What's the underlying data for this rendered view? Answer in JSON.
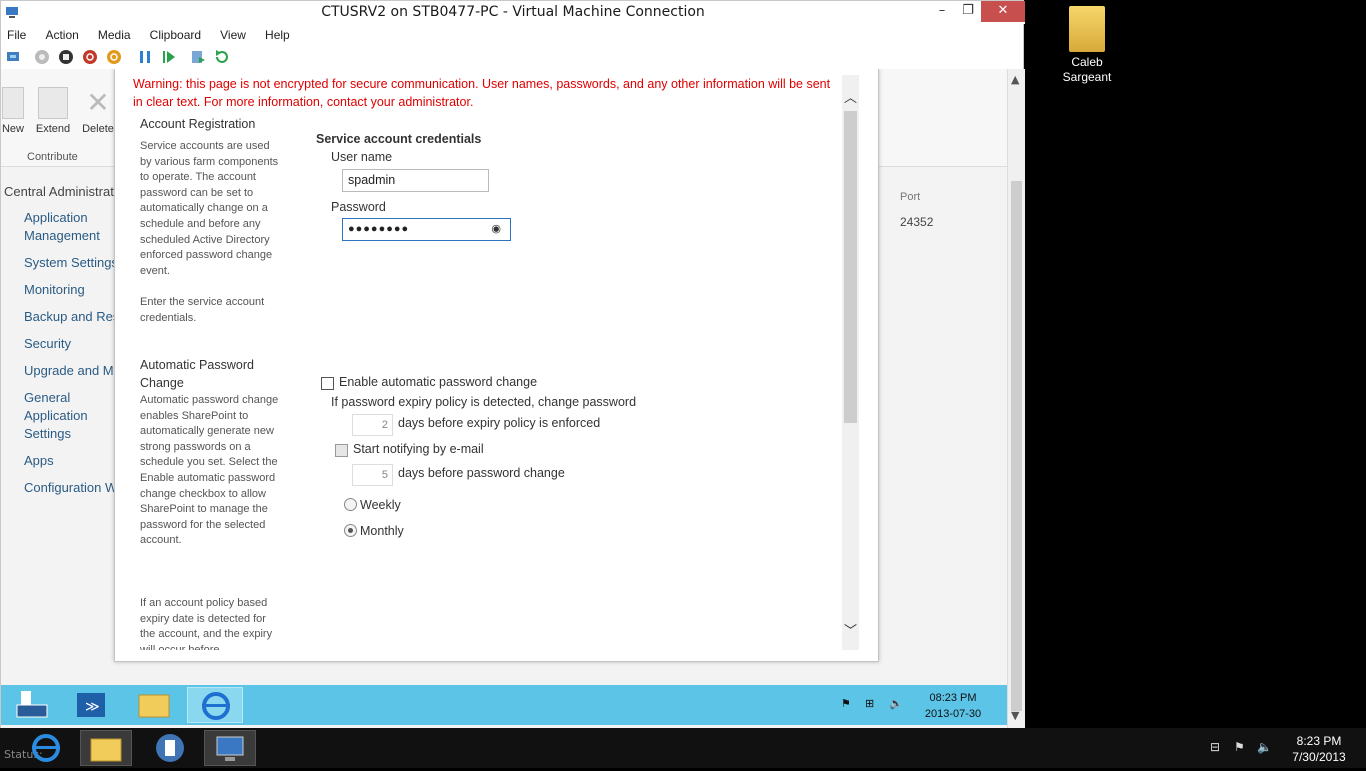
{
  "window": {
    "title": "CTUSRV2 on STB0477-PC - Virtual Machine Connection",
    "min": "–",
    "max": "❐",
    "close": "✕"
  },
  "menu": [
    "File",
    "Action",
    "Media",
    "Clipboard",
    "View",
    "Help"
  ],
  "ribbon": {
    "buttons": [
      "New",
      "Extend",
      "Delete"
    ],
    "group": "Contribute"
  },
  "leftnav": {
    "head": "Central Administration",
    "items": [
      "Application Management",
      "System Settings",
      "Monitoring",
      "Backup and Restore",
      "Security",
      "Upgrade and Migration",
      "General Application Settings",
      "Apps",
      "Configuration Wizards"
    ]
  },
  "port": {
    "label": "Port",
    "value": "24352"
  },
  "dialog": {
    "warning": "Warning: this page is not encrypted for secure communication. User names, passwords, and any other information will be sent in clear text. For more information, contact your administrator.",
    "account": {
      "title": "Account Registration",
      "desc1": "Service accounts are used by various farm components to operate. The account password can be set to automatically change on a schedule and before any scheduled Active Directory enforced password change event.",
      "desc2": "Enter the service account credentials."
    },
    "credentials": {
      "title": "Service account credentials",
      "username_label": "User name",
      "username_value": "spadmin",
      "password_label": "Password",
      "password_value": "●●●●●●●●",
      "reveal_icon": "◉"
    },
    "autopw": {
      "title": "Automatic Password Change",
      "desc1": "Automatic password change enables SharePoint to automatically generate new strong passwords on a schedule you set. Select the Enable automatic password change checkbox to allow SharePoint to manage the password for the selected account.",
      "desc2": "If an account policy based expiry date is detected for the account, and the expiry will occur before",
      "enable_label": "Enable automatic password change",
      "expiry_text": "If password expiry policy is detected, change password",
      "days_before_value": "2",
      "days_before_label": "days before expiry policy is enforced",
      "notify_label": "Start notifying by e-mail",
      "notify_days_value": "5",
      "notify_days_label": "days before password change",
      "weekly": "Weekly",
      "monthly": "Monthly"
    }
  },
  "guest_taskbar": {
    "time": "08:23 PM",
    "date": "2013-07-30",
    "status": "Status: Running"
  },
  "desktop_icon": {
    "label": "Caleb Sargeant"
  },
  "host_clock": {
    "time": "8:23 PM",
    "date": "7/30/2013"
  },
  "colors": {
    "warning": "#e00000",
    "guest_taskbar": "#5bc4e7",
    "link": "#2a5b84"
  }
}
